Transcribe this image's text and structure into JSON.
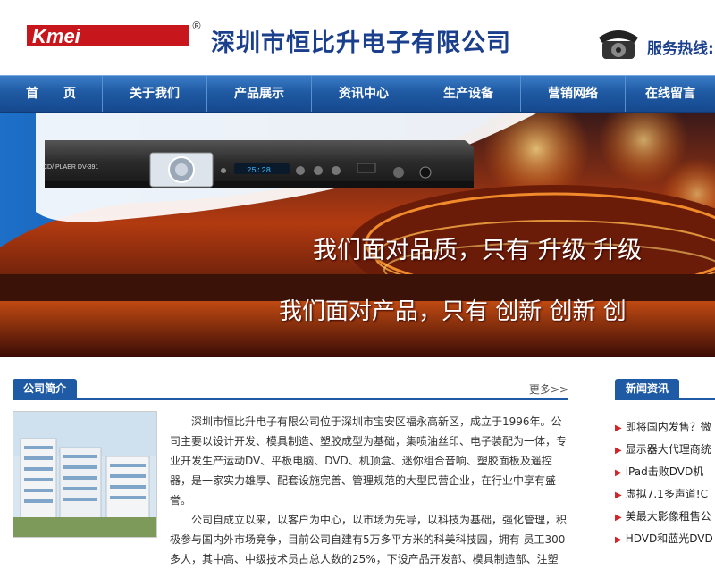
{
  "header": {
    "logo_text": "Kmei",
    "registered_mark": "®",
    "company_name": "深圳市恒比升电子有限公司",
    "hotline_label": "服务热线:"
  },
  "nav": {
    "items": [
      {
        "label": "首　　页"
      },
      {
        "label": "关于我们"
      },
      {
        "label": "产品展示"
      },
      {
        "label": "资讯中心"
      },
      {
        "label": "生产设备"
      },
      {
        "label": "营销网络"
      },
      {
        "label": "在线留言"
      }
    ]
  },
  "banner": {
    "device_label": "CD/ PLAER DV-391",
    "device_display": "25:28",
    "slogan1": "我们面对品质，只有 升级  升级",
    "slogan2": "我们面对产品，只有 创新  创新  创"
  },
  "about": {
    "title": "公司简介",
    "more": "更多>>",
    "paragraphs": [
      "深圳市恒比升电子有限公司位于深圳市宝安区福永高新区，成立于1996年。公司主要以设计开发、模具制造、塑胶成型为基础，集喷油丝印、电子装配为一体，专业开发生产运动DV、平板电脑、DVD、机顶盒、迷你组合音响、塑胶面板及遥控器，是一家实力雄厚、配套设施完善、管理规范的大型民营企业，在行业中享有盛誉。",
      "公司自成立以来，以客户为中心，以市场为先导，以科技为基础，强化管理，积极参与国内外市场竞争，目前公司自建有5万多平方米的科美科技园，拥有 员工300多人，其中高、中级技术员占总人数的25%，下设产品开发部、模具制造部、注塑"
    ]
  },
  "news": {
    "title": "新闻资讯",
    "items": [
      "即将国内发售？微",
      "显示器大代理商统",
      "iPad击败DVD机",
      "虚拟7.1多声道!C",
      "美最大影像租售公",
      "HDVD和蓝光DVD"
    ]
  },
  "colors": {
    "brand_blue": "#1a3f8c",
    "nav_blue": "#1f5aa4",
    "logo_red": "#c8161d",
    "bullet_red": "#d2252a"
  }
}
